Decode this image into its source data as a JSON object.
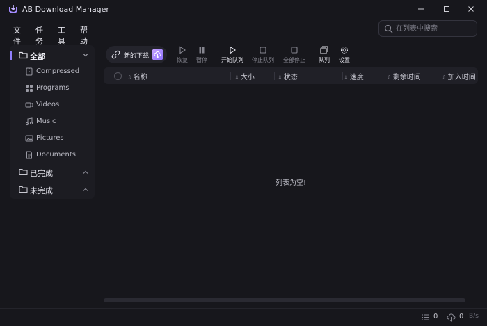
{
  "app": {
    "title": "AB Download Manager",
    "accent": "#8f7dfd"
  },
  "menu": {
    "items": [
      "文件",
      "任务",
      "工具",
      "帮助"
    ]
  },
  "search": {
    "placeholder": "在列表中搜索"
  },
  "sidebar": {
    "all_label": "全部",
    "sub_items": [
      {
        "label": "Compressed",
        "icon": "archive-icon"
      },
      {
        "label": "Programs",
        "icon": "programs-icon"
      },
      {
        "label": "Videos",
        "icon": "video-icon"
      },
      {
        "label": "Music",
        "icon": "music-icon"
      },
      {
        "label": "Pictures",
        "icon": "picture-icon"
      },
      {
        "label": "Documents",
        "icon": "document-icon"
      }
    ],
    "groups": [
      {
        "label": "已完成"
      },
      {
        "label": "未完成"
      }
    ]
  },
  "toolbar": {
    "new_download": "新的下载",
    "resume": "恢复",
    "pause": "暂停",
    "start_queue": "开始队列",
    "stop_queue": "停止队列",
    "stop_all": "全部停止",
    "queues": "队列",
    "settings": "设置"
  },
  "table": {
    "columns": {
      "name": "名称",
      "size": "大小",
      "status": "状态",
      "speed": "速度",
      "time_left": "剩余时间",
      "date_added": "加入时间"
    },
    "empty_message": "列表为空!"
  },
  "status": {
    "list_count": "0",
    "active_count": "0",
    "speed": "B/s"
  }
}
